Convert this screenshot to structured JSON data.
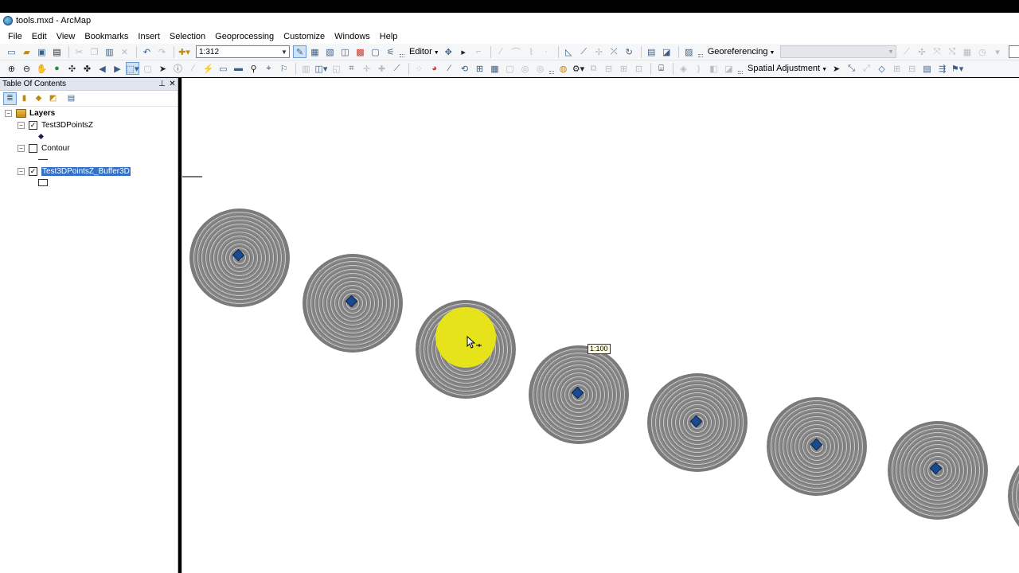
{
  "window": {
    "title": "tools.mxd - ArcMap"
  },
  "menu": [
    "File",
    "Edit",
    "View",
    "Bookmarks",
    "Insert",
    "Selection",
    "Geoprocessing",
    "Customize",
    "Windows",
    "Help"
  ],
  "toolbar": {
    "scale": "1:312",
    "editor_label": "Editor",
    "georeferencing_label": "Georeferencing",
    "spatial_adjustment_label": "Spatial Adjustment"
  },
  "toc": {
    "title": "Table Of Contents",
    "root_label": "Layers",
    "layers": [
      {
        "name": "Test3DPointsZ",
        "checked": true,
        "symbol": "diamond"
      },
      {
        "name": "Contour",
        "checked": false,
        "symbol": "line"
      },
      {
        "name": "Test3DPointsZ_Buffer3D",
        "checked": true,
        "symbol": "rectangle",
        "selected": true
      }
    ]
  },
  "map": {
    "scale_tooltip": "1:100",
    "highlight_color": "#e7e31a",
    "buffer_color": "#8a8a8a",
    "point_color": "#1b4b8f"
  }
}
